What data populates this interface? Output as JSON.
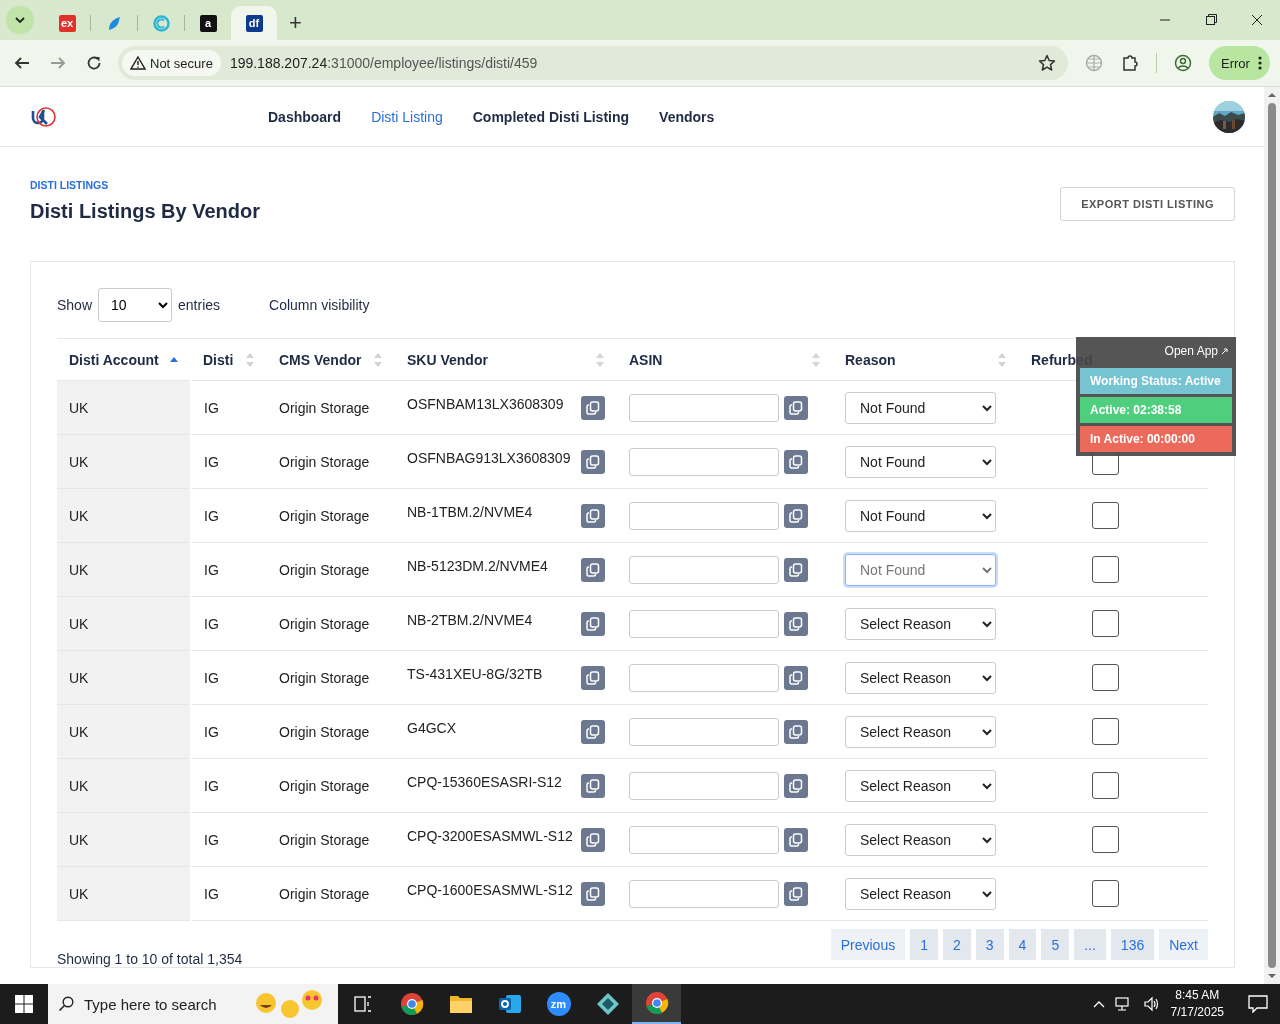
{
  "browser": {
    "tabs": [
      {
        "kind": "letter",
        "label": "ex",
        "color": "#e0312b",
        "selected": false
      },
      {
        "kind": "logo",
        "color": "#1e88e5",
        "selected": false
      },
      {
        "kind": "ring",
        "color": "#29b6d8",
        "selected": false
      },
      {
        "kind": "letter",
        "label": "a",
        "color": "#111111",
        "selected": false
      },
      {
        "kind": "letter",
        "label": "df",
        "color": "#0d3a8c",
        "selected": true
      }
    ],
    "new_tab": "+",
    "security": "Not secure",
    "url_host": "199.188.207.24",
    "url_path": ":31000/employee/listings/disti/459",
    "profile_button": "Error"
  },
  "nav": {
    "links": [
      {
        "label": "Dashboard",
        "selected": false
      },
      {
        "label": "Disti Listing",
        "selected": true
      },
      {
        "label": "Completed Disti Listing",
        "selected": false
      },
      {
        "label": "Vendors",
        "selected": false
      }
    ]
  },
  "breadcrumb": "DISTI LISTINGS",
  "title": "Disti Listings By Vendor",
  "export_button": "EXPORT DISTI LISTING",
  "length_menu": {
    "prefix": "Show",
    "value": "10",
    "suffix": "entries"
  },
  "column_visibility": "Column visibility",
  "table": {
    "columns": [
      {
        "label": "Disti Account",
        "sorted": true
      },
      {
        "label": "Disti",
        "sorted": false
      },
      {
        "label": "CMS Vendor",
        "sorted": false
      },
      {
        "label": "SKU Vendor",
        "sorted": false
      },
      {
        "label": "ASIN",
        "sorted": false
      },
      {
        "label": "Reason",
        "sorted": false
      },
      {
        "label": "Refurbed"
      }
    ],
    "rows": [
      {
        "disti_account": "UK",
        "disti": "IG",
        "cms_vendor": "Origin Storage",
        "sku_vendor": "OSFNBAM13LX3608309",
        "reason": "Not Found",
        "focused": false
      },
      {
        "disti_account": "UK",
        "disti": "IG",
        "cms_vendor": "Origin Storage",
        "sku_vendor": "OSFNBAG913LX3608309",
        "reason": "Not Found",
        "focused": false,
        "refurbed": false
      },
      {
        "disti_account": "UK",
        "disti": "IG",
        "cms_vendor": "Origin Storage",
        "sku_vendor": "NB-1TBM.2/NVME4",
        "reason": "Not Found",
        "focused": false,
        "refurbed": false
      },
      {
        "disti_account": "UK",
        "disti": "IG",
        "cms_vendor": "Origin Storage",
        "sku_vendor": "NB-5123DM.2/NVME4",
        "reason": "Not Found",
        "focused": true,
        "refurbed": false
      },
      {
        "disti_account": "UK",
        "disti": "IG",
        "cms_vendor": "Origin Storage",
        "sku_vendor": "NB-2TBM.2/NVME4",
        "reason": "Select Reason",
        "focused": false,
        "refurbed": false
      },
      {
        "disti_account": "UK",
        "disti": "IG",
        "cms_vendor": "Origin Storage",
        "sku_vendor": "TS-431XEU-8G/32TB",
        "reason": "Select Reason",
        "focused": false,
        "refurbed": false
      },
      {
        "disti_account": "UK",
        "disti": "IG",
        "cms_vendor": "Origin Storage",
        "sku_vendor": "G4GCX",
        "reason": "Select Reason",
        "focused": false,
        "refurbed": false
      },
      {
        "disti_account": "UK",
        "disti": "IG",
        "cms_vendor": "Origin Storage",
        "sku_vendor": "CPQ-15360ESASRI-S12",
        "reason": "Select Reason",
        "focused": false,
        "refurbed": false
      },
      {
        "disti_account": "UK",
        "disti": "IG",
        "cms_vendor": "Origin Storage",
        "sku_vendor": "CPQ-3200ESASMWL-S12",
        "reason": "Select Reason",
        "focused": false,
        "refurbed": false
      },
      {
        "disti_account": "UK",
        "disti": "IG",
        "cms_vendor": "Origin Storage",
        "sku_vendor": "CPQ-1600ESASMWL-S12",
        "reason": "Select Reason",
        "focused": false,
        "refurbed": false
      }
    ]
  },
  "info": "Showing 1 to 10 of total 1,354",
  "pagination": [
    {
      "kind": "nav",
      "label": "Previous"
    },
    {
      "kind": "page",
      "label": "1"
    },
    {
      "kind": "page",
      "label": "2"
    },
    {
      "kind": "page",
      "label": "3"
    },
    {
      "kind": "page",
      "label": "4"
    },
    {
      "kind": "page",
      "label": "5"
    },
    {
      "kind": "page",
      "label": "..."
    },
    {
      "kind": "page",
      "label": "136"
    },
    {
      "kind": "nav",
      "label": "Next"
    }
  ],
  "tracker": {
    "open_app": "Open App",
    "status": "Working Status: Active",
    "active": "Active: 02:38:58",
    "inactive": "In Active: 00:00:00"
  },
  "taskbar": {
    "search_placeholder": "Type here to search",
    "apps": [
      {
        "kind": "chrome",
        "selected": false
      },
      {
        "kind": "folder",
        "selected": false
      },
      {
        "kind": "outlook",
        "selected": false
      },
      {
        "kind": "zoom",
        "label": "zm",
        "selected": false
      },
      {
        "kind": "diamond",
        "selected": false
      },
      {
        "kind": "chrome",
        "selected": true
      }
    ],
    "time": "8:45 AM",
    "date": "7/17/2025"
  }
}
